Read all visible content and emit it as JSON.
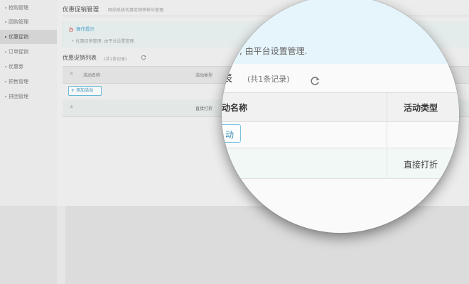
{
  "sidebar": {
    "items": [
      {
        "label": "抢购管理",
        "active": false
      },
      {
        "label": "团购管理",
        "active": false
      },
      {
        "label": "优惠促销",
        "active": true
      },
      {
        "label": "订单促销",
        "active": false
      },
      {
        "label": "优惠券",
        "active": false
      },
      {
        "label": "预售管理",
        "active": false
      },
      {
        "label": "拼团管理",
        "active": false
      }
    ]
  },
  "page": {
    "title": "优惠促销管理",
    "subtitle": "网站系统优惠促销审核与管理"
  },
  "tips": {
    "heading": "操作提示",
    "text": "优惠促销管理, 由平台设置管理."
  },
  "list": {
    "title": "优惠促销列表",
    "count": "(共1条记录)",
    "columns": {
      "name": "活动名称",
      "type": "活动类型"
    },
    "add_button": "添加活动",
    "rows": [
      {
        "name": "",
        "type": "直接打折"
      }
    ]
  },
  "magnifier": {
    "tip_fragment": ", 由平台设置管理.",
    "title_fragment": "表",
    "count": "(共1条记录)",
    "column_name_fragment": "动名称",
    "column_type": "活动类型",
    "button_fragment": "动",
    "row_type": "直接打折"
  },
  "colors": {
    "accent": "#3a8fb8",
    "tip_band": "#e6f4fb",
    "row_highlight": "#f1f8f5"
  }
}
